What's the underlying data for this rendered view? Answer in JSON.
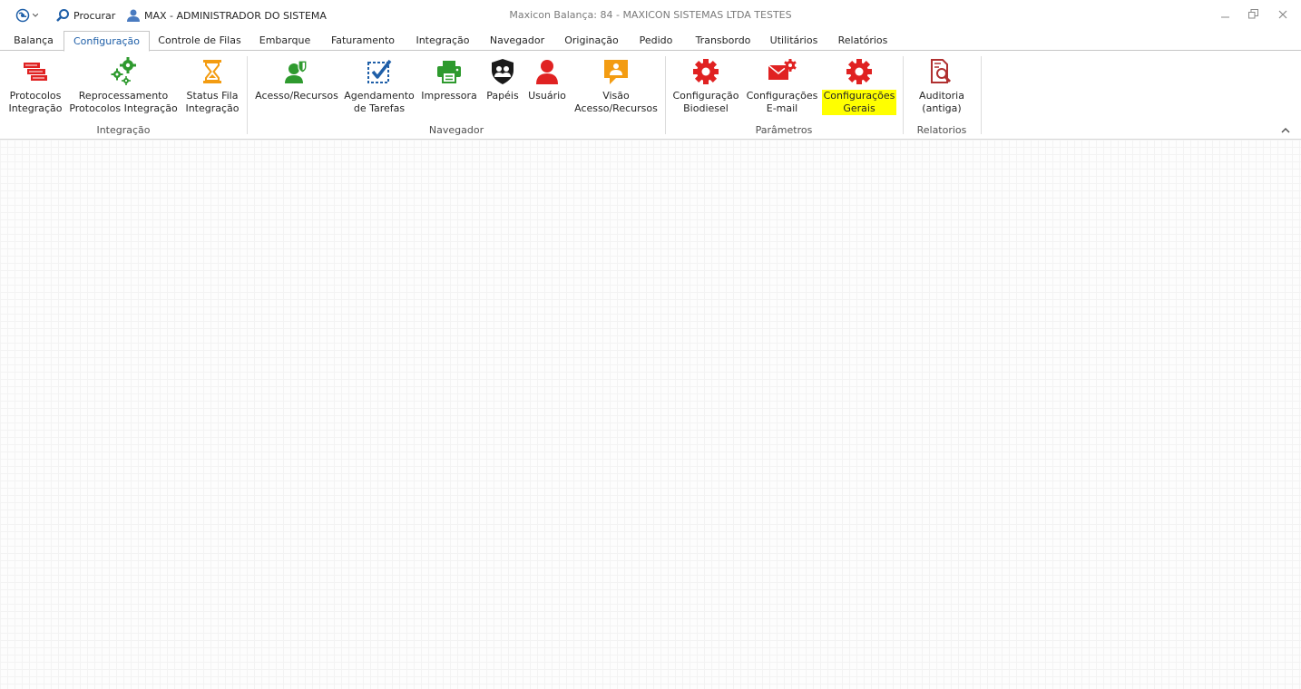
{
  "quick_access": {
    "search_label": "Procurar",
    "user_label": "MAX - ADMINISTRADOR DO SISTEMA"
  },
  "window": {
    "title": "Maxicon Balança: 84 - MAXICON SISTEMAS LTDA TESTES"
  },
  "tabs": [
    {
      "label": "Balança"
    },
    {
      "label": "Configuração",
      "active": true
    },
    {
      "label": "Controle de Filas"
    },
    {
      "label": "Embarque"
    },
    {
      "label": "Faturamento"
    },
    {
      "label": "Integração"
    },
    {
      "label": "Navegador"
    },
    {
      "label": "Originação"
    },
    {
      "label": "Pedido"
    },
    {
      "label": "Transbordo"
    },
    {
      "label": "Utilitários"
    },
    {
      "label": "Relatórios"
    }
  ],
  "groups": {
    "integracao": {
      "label": "Integração",
      "buttons": [
        {
          "line1": "Protocolos",
          "line2": "Integração",
          "icon": "protocol-stack-icon"
        },
        {
          "line1": "Reprocessamento",
          "line2": "Protocolos Integração",
          "icon": "gears-icon"
        },
        {
          "line1": "Status Fila",
          "line2": "Integração",
          "icon": "hourglass-icon"
        }
      ]
    },
    "navegador": {
      "label": "Navegador",
      "buttons": [
        {
          "line1": "Acesso/Recursos",
          "line2": "",
          "icon": "user-shield-icon"
        },
        {
          "line1": "Agendamento",
          "line2": "de Tarefas",
          "icon": "task-check-icon"
        },
        {
          "line1": "Impressora",
          "line2": "",
          "icon": "printer-icon"
        },
        {
          "line1": "Papéis",
          "line2": "",
          "icon": "roles-badge-icon"
        },
        {
          "line1": "Usuário",
          "line2": "",
          "icon": "user-icon"
        },
        {
          "line1": "Visão",
          "line2": "Acesso/Recursos",
          "icon": "access-view-icon"
        }
      ]
    },
    "parametros": {
      "label": "Parâmetros",
      "buttons": [
        {
          "line1": "Configuração",
          "line2": "Biodiesel",
          "icon": "gear-icon"
        },
        {
          "line1": "Configurações",
          "line2": "E-mail",
          "icon": "mail-gear-icon"
        },
        {
          "line1": "Configurações",
          "line2": "Gerais",
          "icon": "gear-icon",
          "highlighted": true
        }
      ]
    },
    "relatorios": {
      "label": "Relatorios",
      "buttons": [
        {
          "line1": "Auditoria",
          "line2": "(antiga)",
          "icon": "audit-report-icon"
        }
      ]
    }
  },
  "colors": {
    "accent_blue": "#1f5fa8",
    "icon_red": "#e02222",
    "icon_green": "#2e9a2e",
    "icon_orange": "#f39c12",
    "highlight": "#ffff00"
  }
}
